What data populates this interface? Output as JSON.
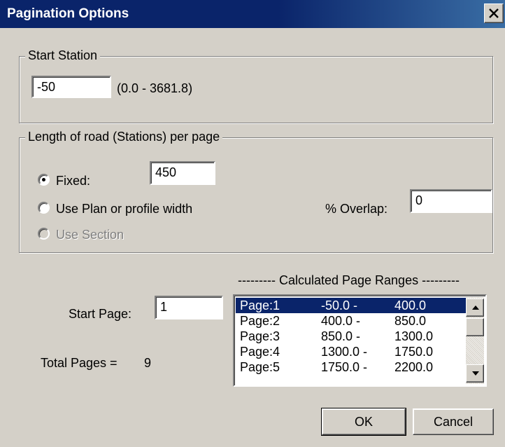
{
  "window": {
    "title": "Pagination Options",
    "close_label": "X"
  },
  "start_station": {
    "group_label": "Start Station",
    "value": "-50",
    "range_text": "(0.0 - 3681.8)"
  },
  "length": {
    "group_label": "Length of road (Stations) per page",
    "options": [
      {
        "label": "Fixed:",
        "checked": true,
        "enabled": true
      },
      {
        "label": "Use Plan or profile width",
        "checked": false,
        "enabled": true
      },
      {
        "label": "Use Section",
        "checked": false,
        "enabled": false
      }
    ],
    "fixed_value": "450",
    "overlap_label": "% Overlap:",
    "overlap_value": "0"
  },
  "pages": {
    "start_page_label": "Start Page:",
    "start_page_value": "1",
    "total_pages_label": "Total Pages =",
    "total_pages_value": "9",
    "ranges_header": "--------- Calculated Page Ranges ---------",
    "rows": [
      {
        "page": "Page:1",
        "from": "-50.0   -",
        "to": "400.0",
        "selected": true
      },
      {
        "page": "Page:2",
        "from": "400.0  -",
        "to": "850.0",
        "selected": false
      },
      {
        "page": "Page:3",
        "from": "850.0  -",
        "to": "1300.0",
        "selected": false
      },
      {
        "page": "Page:4",
        "from": "1300.0  -",
        "to": "1750.0",
        "selected": false
      },
      {
        "page": "Page:5",
        "from": "1750.0  -",
        "to": "2200.0",
        "selected": false
      }
    ]
  },
  "buttons": {
    "ok": "OK",
    "cancel": "Cancel"
  },
  "colors": {
    "titlebar": "#0a246a",
    "selection": "#0a246a",
    "face": "#d4d0c8"
  }
}
